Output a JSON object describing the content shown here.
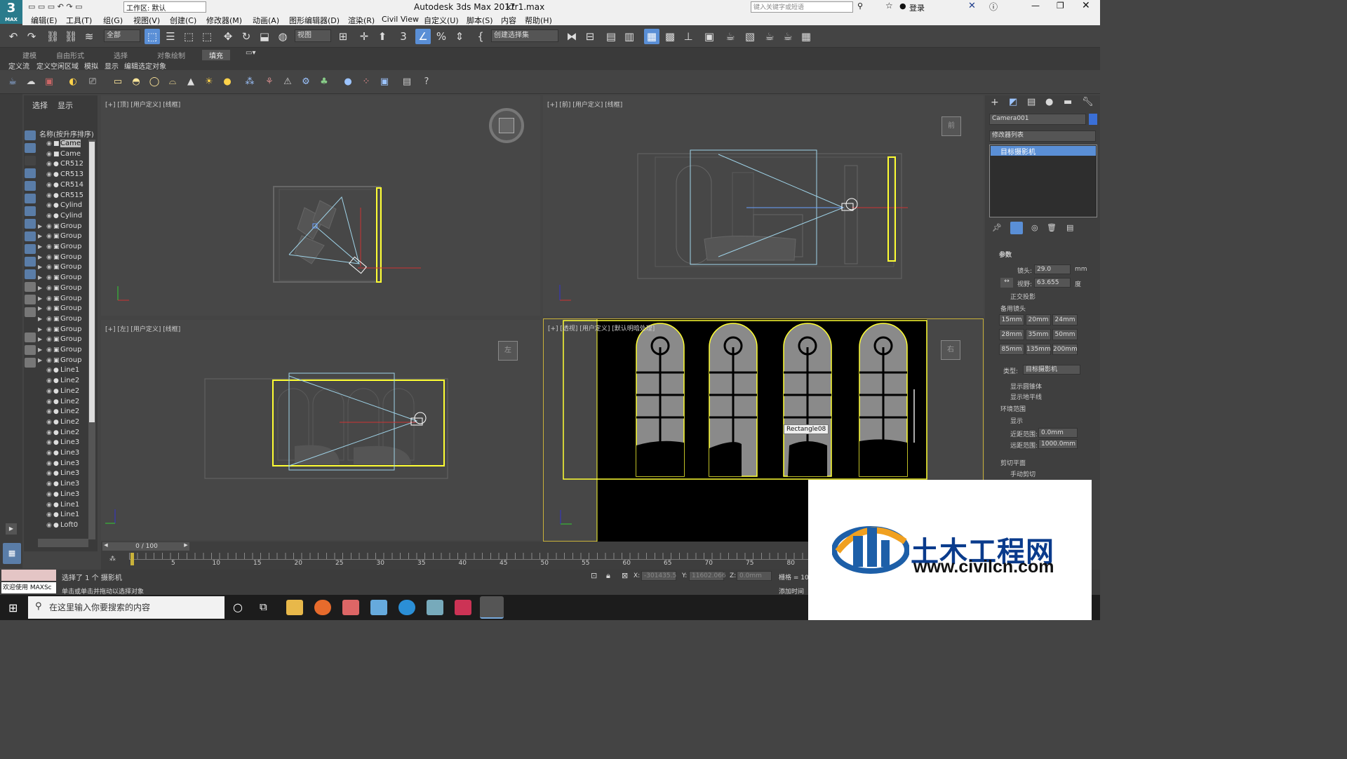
{
  "app": {
    "title": "Autodesk 3ds Max 2017",
    "file": "ktr1.max",
    "logo_text": "3",
    "logo_sub": "MAX"
  },
  "title_bar": {
    "workspace": "工作区: 默认",
    "search_placeholder": "键入关键字或短语",
    "login": "登录"
  },
  "menus": [
    "编辑(E)",
    "工具(T)",
    "组(G)",
    "视图(V)",
    "创建(C)",
    "修改器(M)",
    "动画(A)",
    "图形编辑器(D)",
    "渲染(R)",
    "Civil View",
    "自定义(U)",
    "脚本(S)",
    "内容",
    "帮助(H)"
  ],
  "toolbar": {
    "filter": "全部",
    "ref_coord": "视图",
    "selection_set": "创建选择集"
  },
  "ribbon": {
    "tabs": [
      "建模",
      "自由形式",
      "选择",
      "对象绘制",
      "填充"
    ],
    "subtabs": [
      "定义流",
      "定义空闲区域",
      "模拟",
      "显示",
      "编辑选定对象"
    ]
  },
  "scene_explorer": {
    "tabs": [
      "选择",
      "显示"
    ],
    "column": "名称(按升序排序)",
    "items": [
      "Came",
      "Came",
      "CR512",
      "CR513",
      "CR514",
      "CR515",
      "Cylind",
      "Cylind",
      "Group",
      "Group",
      "Group",
      "Group",
      "Group",
      "Group",
      "Group",
      "Group",
      "Group",
      "Group",
      "Group",
      "Group",
      "Group",
      "Group",
      "Line1",
      "Line2",
      "Line2",
      "Line2",
      "Line2",
      "Line2",
      "Line2",
      "Line3",
      "Line3",
      "Line3",
      "Line3",
      "Line3",
      "Line3",
      "Line1",
      "Line1",
      "Loft0"
    ]
  },
  "viewports": {
    "top": {
      "label": "[+] [顶] [用户定义] [线框]",
      "cube": ""
    },
    "front": {
      "label": "[+] [前] [用户定义] [线框]",
      "cube": "前"
    },
    "left": {
      "label": "[+] [左] [用户定义] [线框]",
      "cube": "左"
    },
    "persp": {
      "label": "[+] [透视] [用户定义] [默认明暗处理]",
      "cube": "右",
      "tooltip": "Rectangle08"
    }
  },
  "command_panel": {
    "object_name": "Camera001",
    "modifier_list": "修改器列表",
    "stack_item": "目标摄影机",
    "params_title": "参数",
    "lens_label": "镜头:",
    "lens_value": "29.0",
    "lens_unit": "mm",
    "fov_label": "视野:",
    "fov_value": "63.655",
    "fov_unit": "度",
    "ortho": "正交投影",
    "stock_lenses": "备用镜头",
    "lens_buttons": [
      "15mm",
      "20mm",
      "24mm",
      "28mm",
      "35mm",
      "50mm",
      "85mm",
      "135mm",
      "200mm"
    ],
    "type_label": "类型:",
    "type_value": "目标摄影机",
    "show_cone": "显示圆锥体",
    "show_horizon": "显示地平线",
    "env_range": "环境范围",
    "show": "显示",
    "near_label": "近距范围:",
    "near_value": "0.0mm",
    "far_label": "远距范围:",
    "far_value": "1000.0mm",
    "clip": "剪切平面",
    "manual_clip": "手动剪切"
  },
  "timeline": {
    "frame": "0 / 100",
    "ticks": [
      "5",
      "10",
      "15",
      "20",
      "25",
      "30",
      "35",
      "40",
      "45",
      "50",
      "55",
      "60",
      "65",
      "70",
      "75",
      "80"
    ]
  },
  "status": {
    "selected": "选择了 1 个 摄影机",
    "hint": "单击或单击并拖动以选择对象",
    "welcome": "欢迎使用 MAXSc",
    "x_label": "X:",
    "x_value": "-301435.5",
    "y_label": "Y:",
    "y_value": "11602.066",
    "z_label": "Z:",
    "z_value": "0.0mm",
    "grid": "栅格 = 10.",
    "add_time_tag": "添加时间"
  },
  "taskbar": {
    "search_text": "在这里输入你要搜索的内容"
  },
  "watermark": {
    "cn": "土木工程网",
    "url": "www.civilcn.com"
  }
}
